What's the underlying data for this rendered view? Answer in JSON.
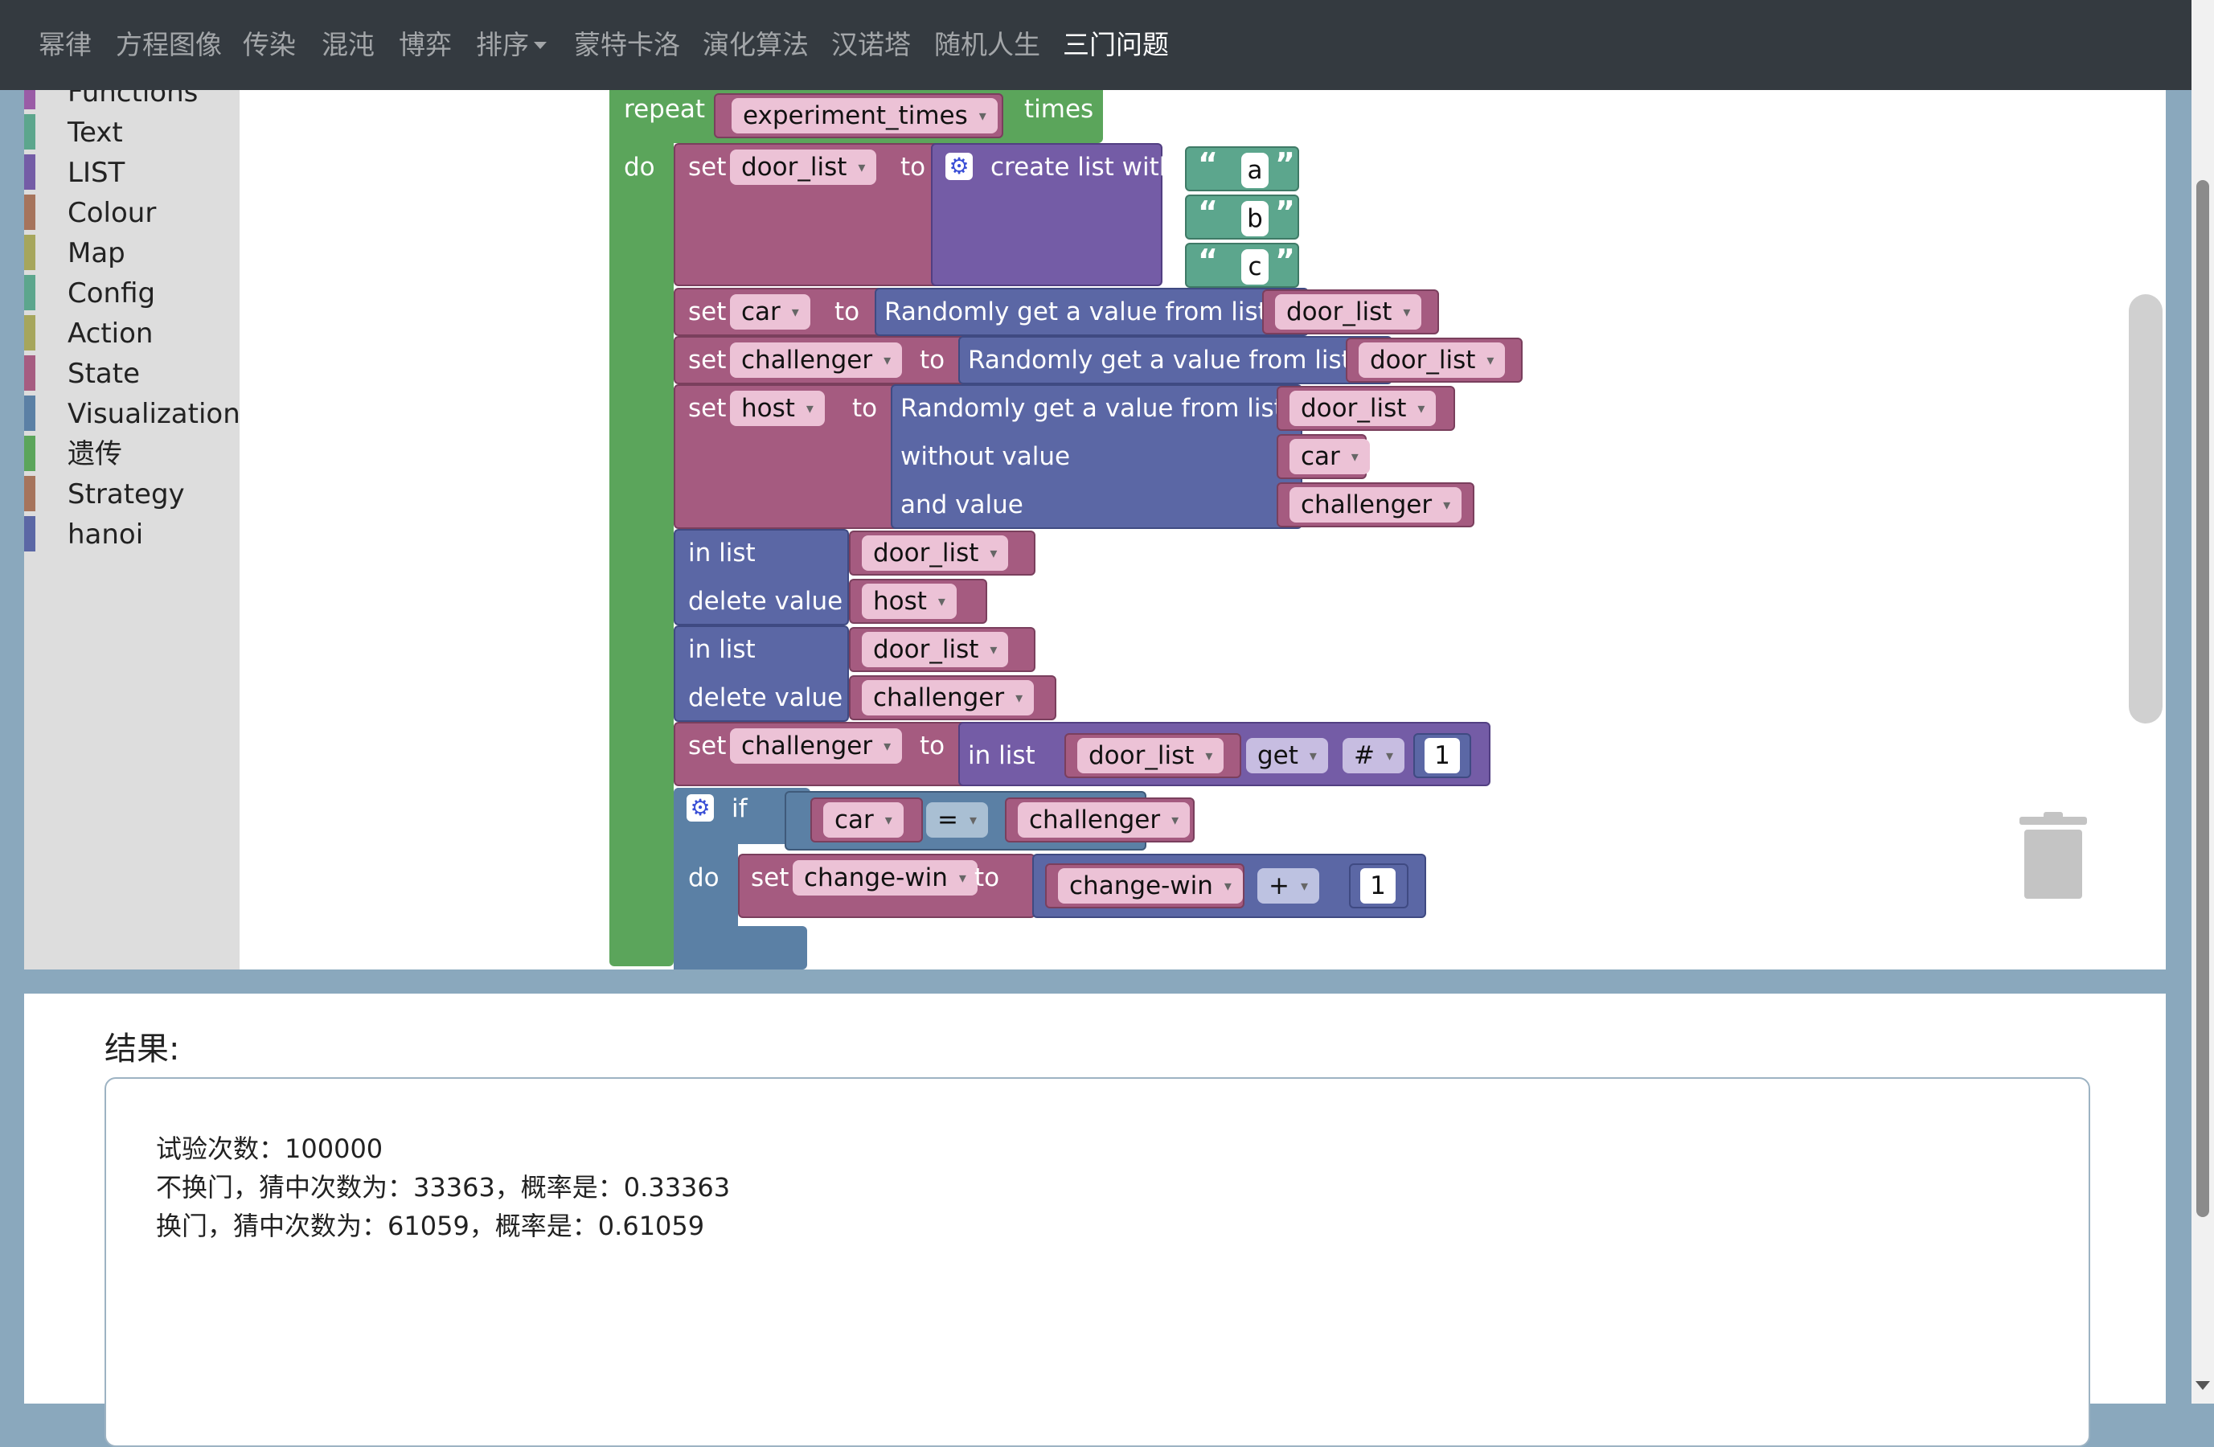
{
  "nav": {
    "items": [
      "幂律",
      "方程图像",
      "传染",
      "混沌",
      "博弈",
      "排序",
      "蒙特卡洛",
      "演化算法",
      "汉诺塔",
      "随机人生"
    ],
    "active": "三门问题"
  },
  "toolbox": {
    "categories": [
      {
        "label": "Functions",
        "color": "#9a5ca6"
      },
      {
        "label": "Text",
        "color": "#5ca68d"
      },
      {
        "label": "LIST",
        "color": "#745ca6"
      },
      {
        "label": "Colour",
        "color": "#a6745c"
      },
      {
        "label": "Map",
        "color": "#a6a65c"
      },
      {
        "label": "Config",
        "color": "#5ca68d"
      },
      {
        "label": "Action",
        "color": "#a6a65c"
      },
      {
        "label": "State",
        "color": "#a65c81"
      },
      {
        "label": "Visualization",
        "color": "#5b80a5"
      },
      {
        "label": "遗传",
        "color": "#5ba55b"
      },
      {
        "label": "Strategy",
        "color": "#a6745c"
      },
      {
        "label": "hanoi",
        "color": "#5b67a5"
      }
    ]
  },
  "blocks": {
    "repeat": {
      "kw": "repeat",
      "var": "experiment_times",
      "times": "times",
      "do": "do"
    },
    "set_door": {
      "set": "set",
      "var": "door_list",
      "to": "to",
      "create": "create list with",
      "items": [
        "a",
        "b",
        "c"
      ]
    },
    "set_car": {
      "set": "set",
      "var": "car",
      "to": "to",
      "fn": "Randomly get a value from list",
      "arg": "door_list"
    },
    "set_challenger": {
      "set": "set",
      "var": "challenger",
      "to": "to",
      "fn": "Randomly get a value from list",
      "arg": "door_list"
    },
    "set_host": {
      "set": "set",
      "var": "host",
      "to": "to",
      "fn": "Randomly get a value from list",
      "arg": "door_list",
      "without": "without value",
      "without_arg": "car",
      "and": "and value",
      "and_arg": "challenger"
    },
    "del1": {
      "in_list": "in list",
      "list": "door_list",
      "delete": "delete value",
      "value": "host"
    },
    "del2": {
      "in_list": "in list",
      "list": "door_list",
      "delete": "delete value",
      "value": "challenger"
    },
    "set_challenger2": {
      "set": "set",
      "var": "challenger",
      "to": "to",
      "in_list": "in list",
      "list": "door_list",
      "op": "get",
      "where": "#",
      "index": "1"
    },
    "if": {
      "kw": "if",
      "left": "car",
      "op": "=",
      "right": "challenger",
      "do": "do"
    },
    "set_win": {
      "set": "set",
      "var": "change-win",
      "to": "to",
      "left": "change-win",
      "op": "+",
      "right": "1"
    }
  },
  "result": {
    "title": "结果:",
    "lines": [
      "试验次数：100000",
      "不换门，猜中次数为：33363，概率是：0.33363",
      "换门，猜中次数为：61059，概率是：0.61059"
    ]
  },
  "colors": {
    "navbar": "#343a40",
    "loop_green": "#5ba55b",
    "variable_pink": "#a55b80",
    "list_purple": "#745ca6",
    "text_teal": "#5ca68d",
    "custom_blue": "#5b67a5",
    "logic_blue": "#5b80a5"
  }
}
